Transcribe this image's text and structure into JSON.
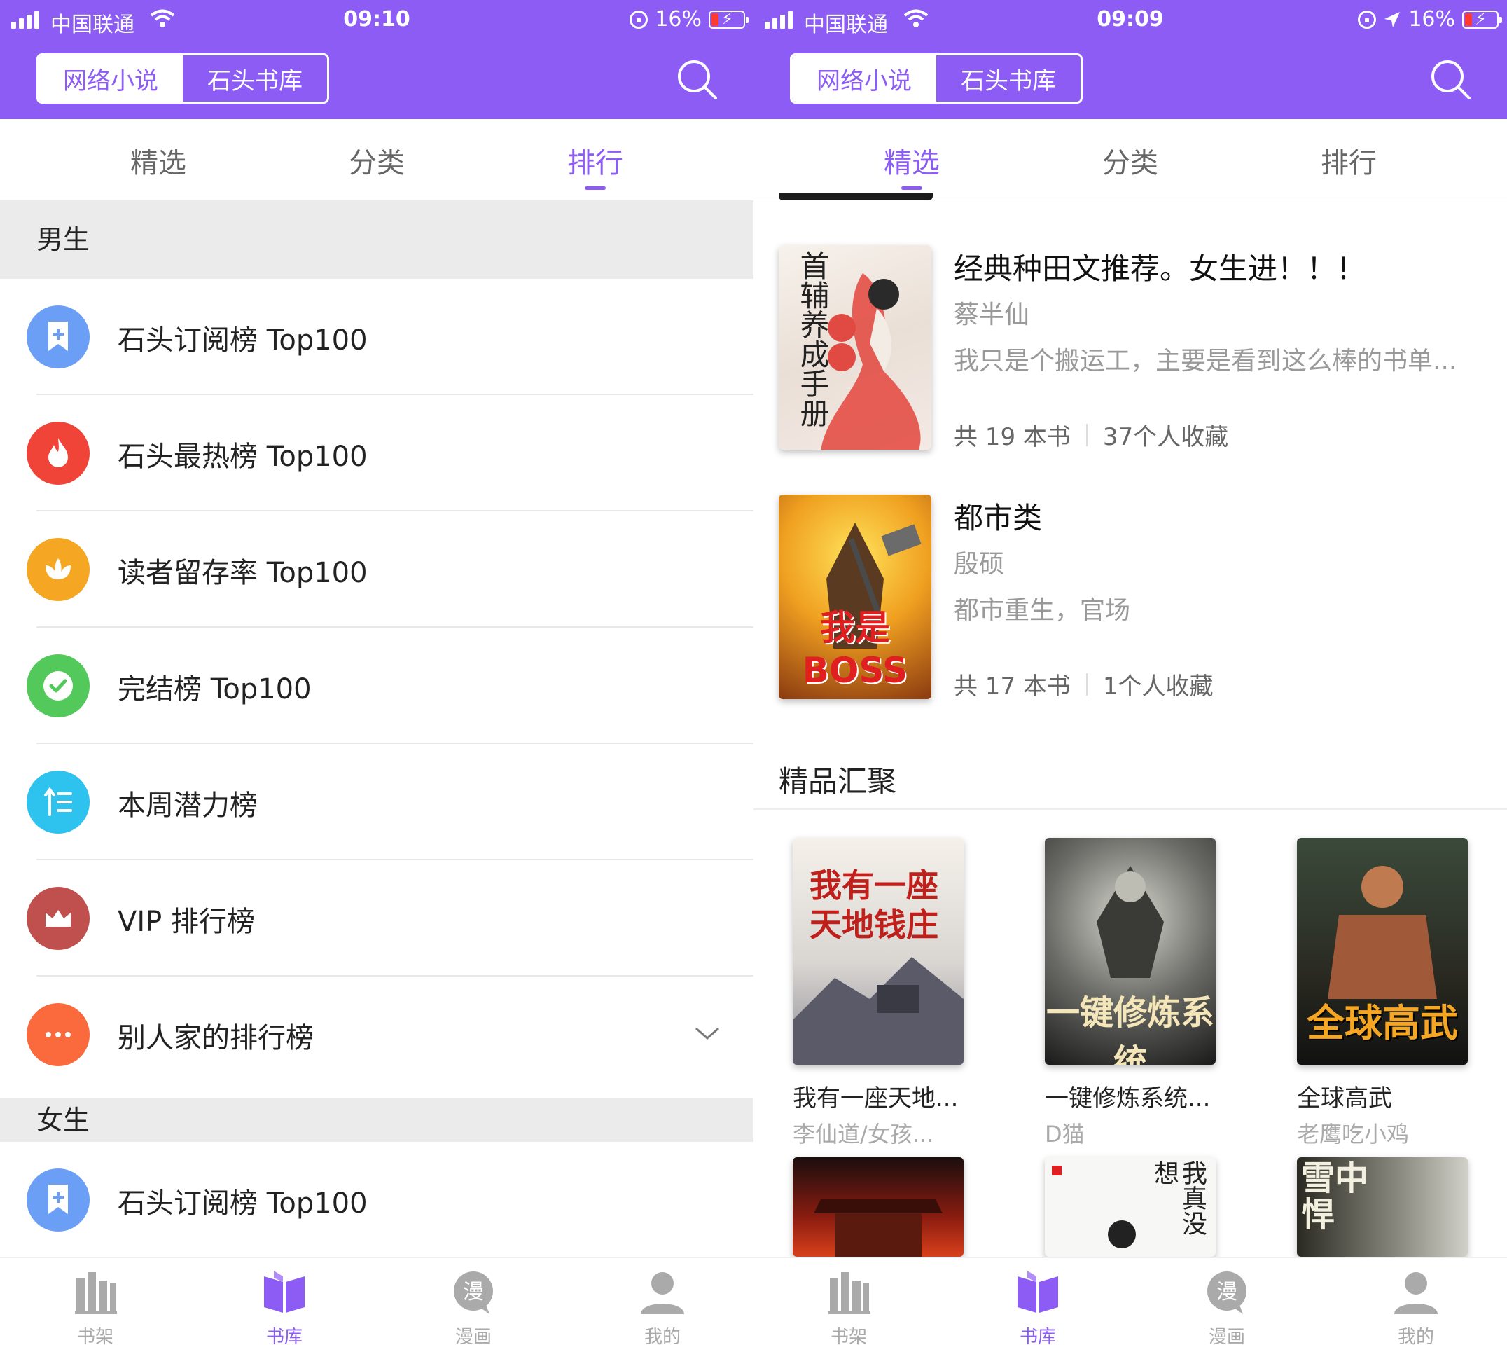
{
  "colors": {
    "accent": "#8c5cf5",
    "section_bg": "#ebebeb"
  },
  "left": {
    "status": {
      "carrier": "中国联通",
      "time": "09:10",
      "battery": "16%"
    },
    "segmented": {
      "left": "网络小说",
      "right": "石头书库",
      "selected": "网络小说"
    },
    "tabs": [
      "精选",
      "分类",
      "排行"
    ],
    "active_tab": "排行",
    "sections": {
      "male": "男生",
      "female": "女生"
    },
    "male_items": [
      {
        "label": "石头订阅榜 Top100",
        "icon": "bookmark-plus-icon",
        "color": "#6b9ef5"
      },
      {
        "label": "石头最热榜 Top100",
        "icon": "flame-icon",
        "color": "#f04438"
      },
      {
        "label": "读者留存率 Top100",
        "icon": "lotus-icon",
        "color": "#f5a623"
      },
      {
        "label": "完结榜 Top100",
        "icon": "check-icon",
        "color": "#52c95a"
      },
      {
        "label": "本周潜力榜",
        "icon": "trend-up-icon",
        "color": "#2ec2ef"
      },
      {
        "label": "VIP 排行榜",
        "icon": "crown-icon",
        "color": "#c0504d"
      },
      {
        "label": "别人家的排行榜",
        "icon": "more-icon",
        "color": "#fb6a3d"
      }
    ],
    "female_items": [
      {
        "label": "石头订阅榜 Top100",
        "icon": "bookmark-plus-icon",
        "color": "#6b9ef5"
      }
    ],
    "bottom_nav": [
      "书架",
      "书库",
      "漫画",
      "我的"
    ],
    "active_nav": "书库"
  },
  "right": {
    "status": {
      "carrier": "中国联通",
      "time": "09:09",
      "battery": "16%"
    },
    "segmented": {
      "left": "网络小说",
      "right": "石头书库",
      "selected": "网络小说"
    },
    "tabs": [
      "精选",
      "分类",
      "排行"
    ],
    "active_tab": "精选",
    "booklists": [
      {
        "title": "经典种田文推荐。女生进！！！",
        "author": "蔡半仙",
        "desc": "我只是个搬运工，主要是看到这么棒的书单...",
        "count": "共 19 本书",
        "fav": "37个人收藏",
        "cover_text": "首辅养成手册"
      },
      {
        "title": "都市类",
        "author": "殷硕",
        "desc": "都市重生，官场",
        "count": "共 17 本书",
        "fav": "1个人收藏",
        "cover_text": "我是BOSS"
      }
    ],
    "section_title": "精品汇聚",
    "grid": [
      {
        "title": "我有一座天地...",
        "author": "李仙道/女孩...",
        "cover_text": "我有一座天地钱庄"
      },
      {
        "title": "一键修炼系统...",
        "author": "D猫",
        "cover_text": "一键修炼系统"
      },
      {
        "title": "全球高武",
        "author": "老鹰吃小鸡",
        "cover_text": "全球高武"
      }
    ],
    "grid_row2_covers": [
      "",
      "我真没想",
      "雪中悍"
    ],
    "bottom_nav": [
      "书架",
      "书库",
      "漫画",
      "我的"
    ],
    "active_nav": "书库"
  }
}
